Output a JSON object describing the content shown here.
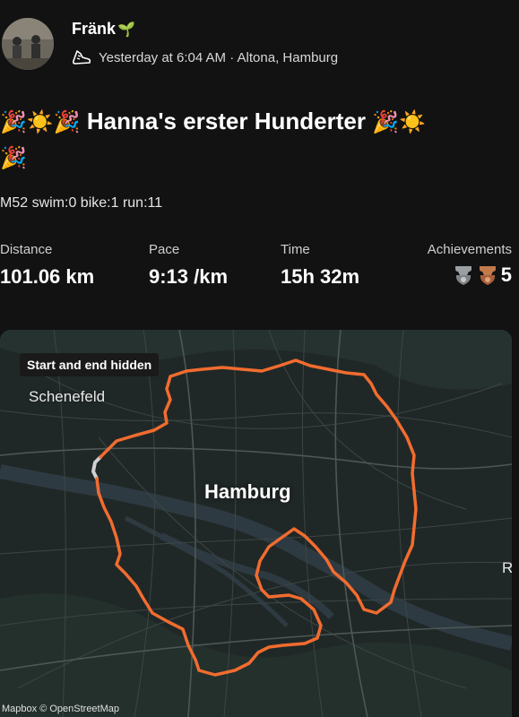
{
  "post": {
    "athlete_name": "Fränk",
    "athlete_emoji": "🌱",
    "meta_text": "Yesterday at 6:04 AM · Altona, Hamburg",
    "activity_icon": "shoe-icon",
    "title_prefix": "🎉☀️🎉",
    "title_text": " Hanna's erster Hunderter ",
    "title_suffix": "🎉☀️",
    "title_wrap": "🎉",
    "description": "M52 swim:0 bike:1 run:11"
  },
  "stats": {
    "distance_label": "Distance",
    "distance_value": "101.06 km",
    "pace_label": "Pace",
    "pace_value": "9:13 /km",
    "time_label": "Time",
    "time_value": "15h 32m",
    "achievements_label": "Achievements",
    "achievements_count": "5",
    "achievement_icons": [
      "silver-trophy-icon",
      "bronze-trophy-icon"
    ]
  },
  "map": {
    "hidden_label": "Start and end hidden",
    "places": {
      "hamburg": "Hamburg",
      "schenefeld": "Schenefeld",
      "cut": "R"
    },
    "attribution": "Mapbox © OpenStreetMap",
    "route_color": "#f26c2f"
  }
}
